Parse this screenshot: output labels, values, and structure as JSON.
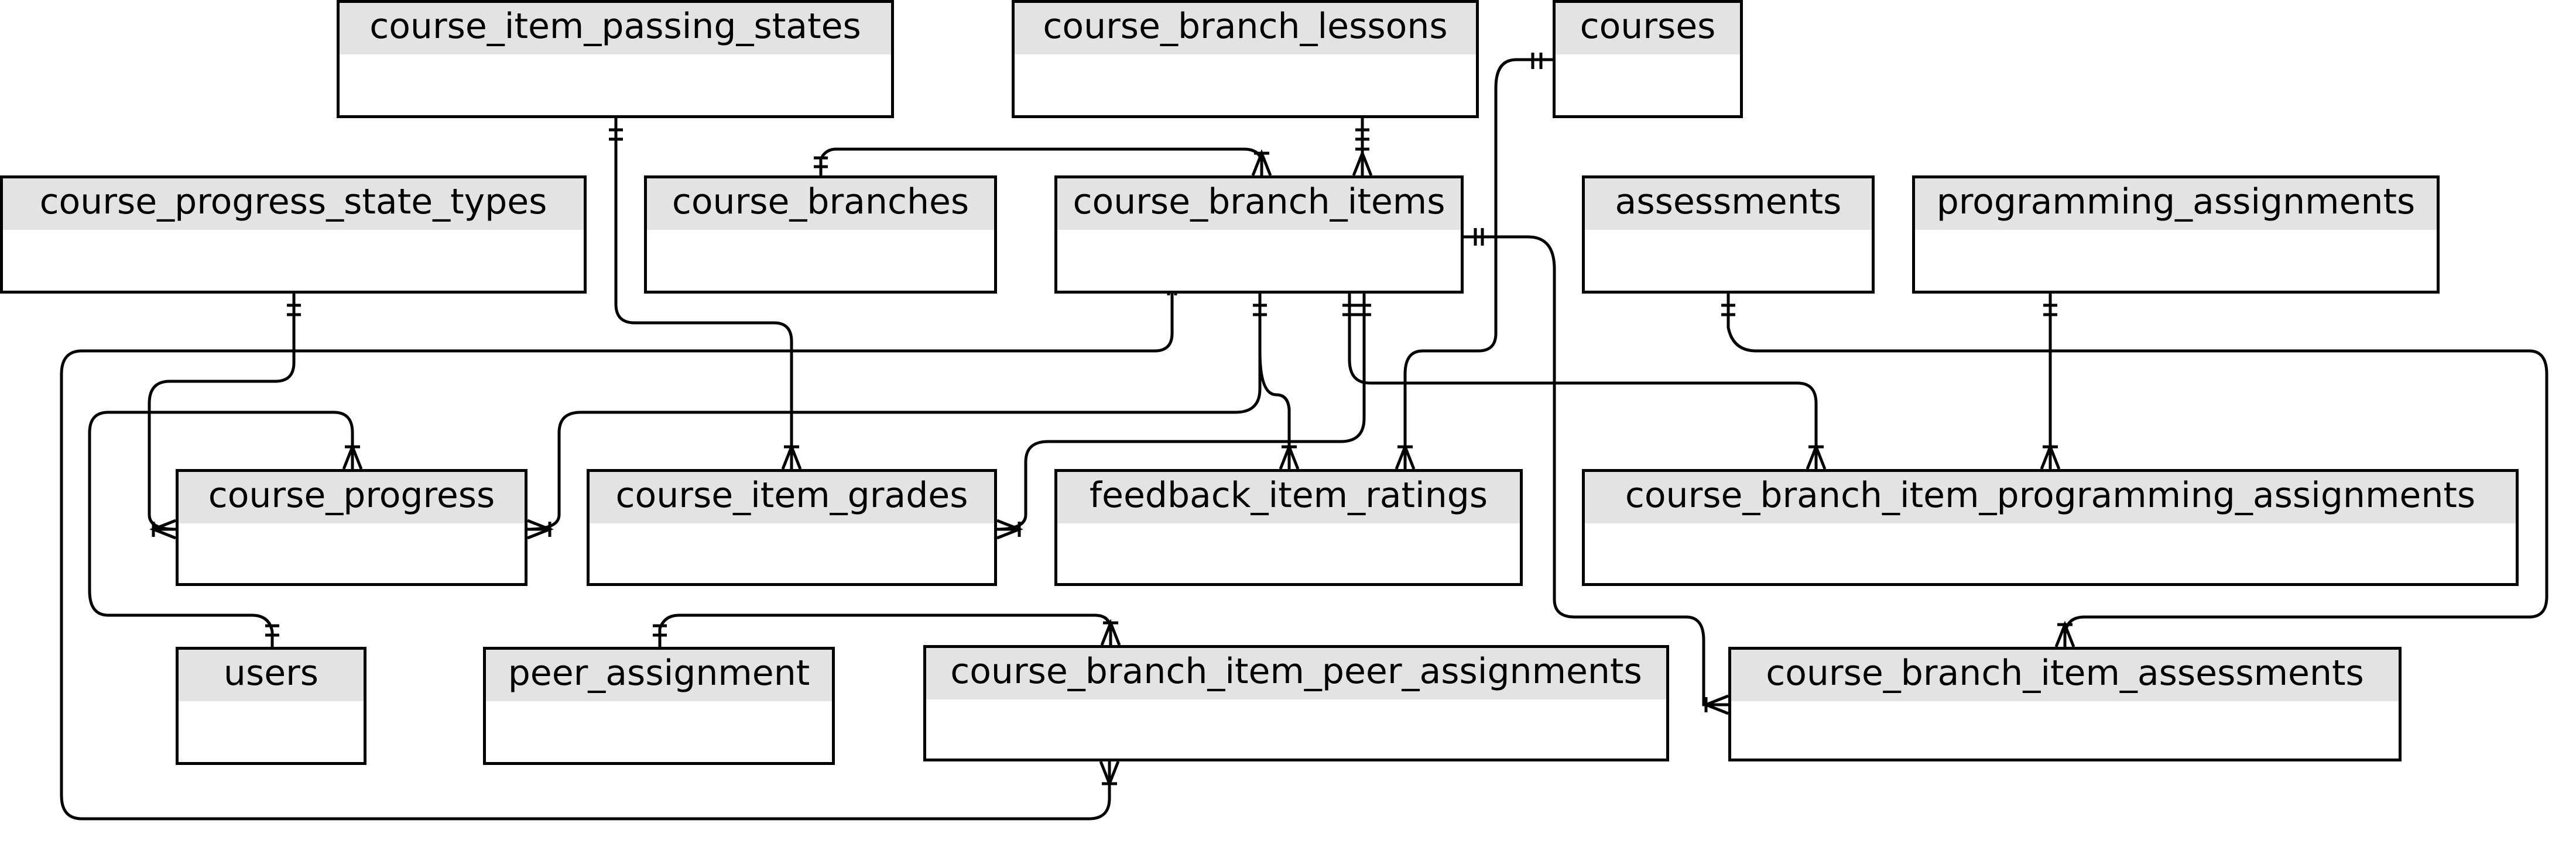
{
  "diagram": {
    "type": "entity-relationship",
    "entities": [
      {
        "id": "course_item_passing_states",
        "name": "course_item_passing_states"
      },
      {
        "id": "course_branch_lessons",
        "name": "course_branch_lessons"
      },
      {
        "id": "courses",
        "name": "courses"
      },
      {
        "id": "course_progress_state_types",
        "name": "course_progress_state_types"
      },
      {
        "id": "course_branches",
        "name": "course_branches"
      },
      {
        "id": "course_branch_items",
        "name": "course_branch_items"
      },
      {
        "id": "assessments",
        "name": "assessments"
      },
      {
        "id": "programming_assignments",
        "name": "programming_assignments"
      },
      {
        "id": "course_progress",
        "name": "course_progress"
      },
      {
        "id": "course_item_grades",
        "name": "course_item_grades"
      },
      {
        "id": "feedback_item_ratings",
        "name": "feedback_item_ratings"
      },
      {
        "id": "course_branch_item_programming_assignments",
        "name": "course_branch_item_programming_assignments"
      },
      {
        "id": "users",
        "name": "users"
      },
      {
        "id": "peer_assignment",
        "name": "peer_assignment"
      },
      {
        "id": "course_branch_item_peer_assignments",
        "name": "course_branch_item_peer_assignments"
      },
      {
        "id": "course_branch_item_assessments",
        "name": "course_branch_item_assessments"
      }
    ],
    "relationships": [
      {
        "from": "course_item_passing_states",
        "to": "course_item_grades",
        "from_card": "one-and-only-one",
        "to_card": "one-or-many"
      },
      {
        "from": "course_branches",
        "to": "course_branch_items",
        "from_card": "one-and-only-one",
        "to_card": "one-or-many"
      },
      {
        "from": "course_branch_lessons",
        "to": "course_branch_items",
        "from_card": "one-and-only-one",
        "to_card": "one-or-many"
      },
      {
        "from": "courses",
        "to": "feedback_item_ratings",
        "from_card": "one-and-only-one",
        "to_card": "one-or-many"
      },
      {
        "from": "course_progress_state_types",
        "to": "course_progress",
        "from_card": "one-and-only-one",
        "to_card": "one-or-many"
      },
      {
        "from": "course_branch_items",
        "to": "course_progress",
        "from_card": "one-and-only-one",
        "to_card": "one-or-many"
      },
      {
        "from": "course_branch_items",
        "to": "feedback_item_ratings",
        "from_card": "one-and-only-one",
        "to_card": "one-or-many"
      },
      {
        "from": "course_branch_items",
        "to": "course_item_grades",
        "from_card": "one-and-only-one",
        "to_card": "one-or-many"
      },
      {
        "from": "course_branch_items",
        "to": "course_branch_item_programming_assignments",
        "from_card": "one-and-only-one",
        "to_card": "one-or-many"
      },
      {
        "from": "course_branch_items",
        "to": "course_branch_item_peer_assignments",
        "from_card": "one-and-only-one",
        "to_card": "one-or-many"
      },
      {
        "from": "course_branch_items",
        "to": "course_branch_item_assessments",
        "from_card": "one-and-only-one",
        "to_card": "one-or-many"
      },
      {
        "from": "assessments",
        "to": "course_branch_item_assessments",
        "from_card": "one-and-only-one",
        "to_card": "one-or-many"
      },
      {
        "from": "programming_assignments",
        "to": "course_branch_item_programming_assignments",
        "from_card": "one-and-only-one",
        "to_card": "one-or-many"
      },
      {
        "from": "users",
        "to": "course_progress",
        "from_card": "one-and-only-one",
        "to_card": "one-or-many"
      },
      {
        "from": "peer_assignment",
        "to": "course_branch_item_peer_assignments",
        "from_card": "one-and-only-one",
        "to_card": "one-or-many"
      }
    ]
  }
}
